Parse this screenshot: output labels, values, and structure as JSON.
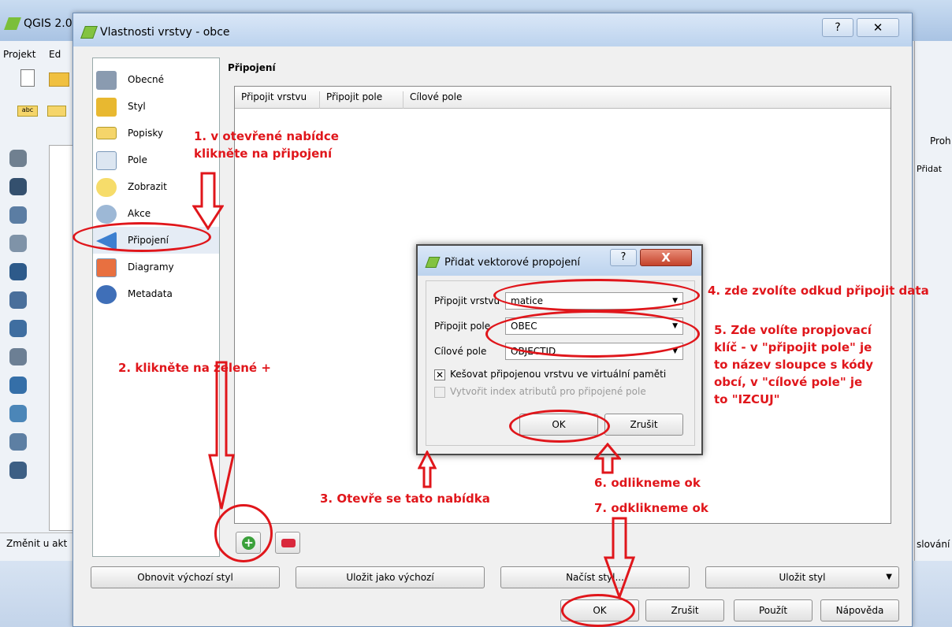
{
  "main_window": {
    "title": "QGIS 2.0",
    "menu": [
      "Projekt",
      "Ed"
    ],
    "status_text": "Změnit u akt",
    "right_panel": {
      "tab": "Proh",
      "add": "Přidat",
      "bottom": "slování"
    }
  },
  "dialog": {
    "title": "Vlastnosti vrstvy - obce",
    "help_label": "?",
    "close_label": "✕",
    "sidebar": [
      {
        "label": "Obecné",
        "icon": "tools-icon"
      },
      {
        "label": "Styl",
        "icon": "brush-icon"
      },
      {
        "label": "Popisky",
        "icon": "abc-label-icon"
      },
      {
        "label": "Pole",
        "icon": "table-icon"
      },
      {
        "label": "Zobrazit",
        "icon": "speech-bubble-icon"
      },
      {
        "label": "Akce",
        "icon": "gear-icon"
      },
      {
        "label": "Připojení",
        "icon": "join-arrow-icon"
      },
      {
        "label": "Diagramy",
        "icon": "diagram-icon"
      },
      {
        "label": "Metadata",
        "icon": "info-icon"
      }
    ],
    "active_item": "Připojení",
    "section_title": "Připojení",
    "table_headers": [
      "Připojit vrstvu",
      "Připojit pole",
      "Cílové pole"
    ],
    "add_label": "+",
    "buttons_row1": {
      "restore_default": "Obnovit výchozí styl",
      "save_default": "Uložit jako výchozí",
      "load_style": "Načíst styl...",
      "save_style": "Uložit styl"
    },
    "buttons_row2": {
      "ok": "OK",
      "cancel": "Zrušit",
      "apply": "Použít",
      "help": "Nápověda"
    }
  },
  "subdialog": {
    "title": "Přidat vektorové propojení",
    "help_label": "?",
    "close_label": "X",
    "join_layer_label": "Připojit vrstvu",
    "join_layer_value": "matice",
    "join_field_label": "Připojit pole",
    "join_field_value": "OBEC",
    "target_field_label": "Cílové pole",
    "target_field_value": "OBJECTID",
    "cache_label": "Kešovat připojenou vrstvu ve virtuální paměti",
    "cache_checked": true,
    "index_label": "Vytvořit index atributů pro připojené pole",
    "index_checked": false,
    "ok": "OK",
    "cancel": "Zrušit"
  },
  "annotations": {
    "step1_line1": "1. v otevřené nabídce",
    "step1_line2": "klikněte na připojení",
    "step2": "2. klikněte na zelené +",
    "step3": "3. Otevře se tato nabídka",
    "step4": "4. zde zvolíte odkud připojit data",
    "step5_line1": "5. Zde volíte propjovací",
    "step5_line2": "klíč - v \"připojit pole\" je",
    "step5_line3": "to název sloupce s kódy",
    "step5_line4": "obcí, v \"cílové pole\" je",
    "step5_line5": "to \"IZCUJ\"",
    "step6": "6. odlikneme ok",
    "step7": "7. odklikneme ok",
    "color": "#e0161b"
  }
}
